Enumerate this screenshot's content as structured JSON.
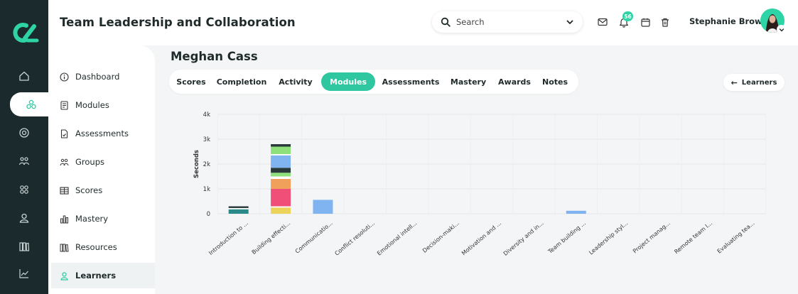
{
  "header": {
    "title": "Team Leadership and Collaboration",
    "search_placeholder": "Search",
    "notification_count": "56",
    "user_name": "Stephanie Brown"
  },
  "rail": {
    "items": [
      "home-icon",
      "modules-icon",
      "target-icon",
      "groups-icon",
      "grid-icon",
      "user-icon",
      "library-icon",
      "analytics-icon"
    ],
    "active_index": 1
  },
  "subnav": {
    "items": [
      {
        "label": "Dashboard",
        "icon": "info-icon"
      },
      {
        "label": "Modules",
        "icon": "module-icon"
      },
      {
        "label": "Assessments",
        "icon": "assessment-icon"
      },
      {
        "label": "Groups",
        "icon": "groups-icon"
      },
      {
        "label": "Scores",
        "icon": "table-icon"
      },
      {
        "label": "Mastery",
        "icon": "bar-chart-icon"
      },
      {
        "label": "Resources",
        "icon": "books-icon"
      },
      {
        "label": "Learners",
        "icon": "user-icon"
      }
    ],
    "active": "Learners"
  },
  "main": {
    "learner_name": "Meghan Cass",
    "tabs": [
      "Scores",
      "Completion",
      "Activity",
      "Modules",
      "Assessments",
      "Mastery",
      "Awards",
      "Notes"
    ],
    "active_tab": "Modules",
    "back_label": "Learners"
  },
  "colors": {
    "accent": "#2fc7a0",
    "rail": "#1b2b2d",
    "background": "#f4f5f6"
  },
  "chart_data": {
    "type": "bar",
    "stacked": true,
    "ylabel": "Seconds",
    "ylim": [
      0,
      4000
    ],
    "yticks": [
      {
        "value": 0,
        "label": "0"
      },
      {
        "value": 1000,
        "label": "1k"
      },
      {
        "value": 2000,
        "label": "2k"
      },
      {
        "value": 3000,
        "label": "3k"
      },
      {
        "value": 4000,
        "label": "4k"
      }
    ],
    "categories": [
      "Introduction to ...",
      "Building effecti...",
      "Communicatio...",
      "Conflict resoluti...",
      "Emotional intell...",
      "Decision-maki...",
      "Motivation and ...",
      "Diversity and in...",
      "Team building ...",
      "Leadership styl...",
      "Project manag...",
      "Remote team l...",
      "Evaluating tea..."
    ],
    "stacks": [
      [
        {
          "value": 180,
          "color": "#2a8a8a"
        },
        {
          "value": 50,
          "color": "#ffffff"
        },
        {
          "value": 70,
          "color": "#2a3a3a"
        }
      ],
      [
        {
          "value": 250,
          "color": "#ecd45a"
        },
        {
          "value": 50,
          "color": "#ffffff"
        },
        {
          "value": 700,
          "color": "#f04f78"
        },
        {
          "value": 100,
          "color": "#f0a05a"
        },
        {
          "value": 300,
          "color": "#f0a05a"
        },
        {
          "value": 100,
          "color": "#ffffff"
        },
        {
          "value": 150,
          "color": "#8ee07a"
        },
        {
          "value": 200,
          "color": "#2a3a3a"
        },
        {
          "value": 500,
          "color": "#7fb4f0"
        },
        {
          "value": 50,
          "color": "#ffffff"
        },
        {
          "value": 300,
          "color": "#8ee07a"
        },
        {
          "value": 100,
          "color": "#2a3a3a"
        }
      ],
      [
        {
          "value": 560,
          "color": "#7fb4f0"
        }
      ],
      [],
      [],
      [],
      [],
      [],
      [
        {
          "value": 120,
          "color": "#7fb4f0"
        }
      ],
      [],
      [],
      [],
      []
    ]
  }
}
